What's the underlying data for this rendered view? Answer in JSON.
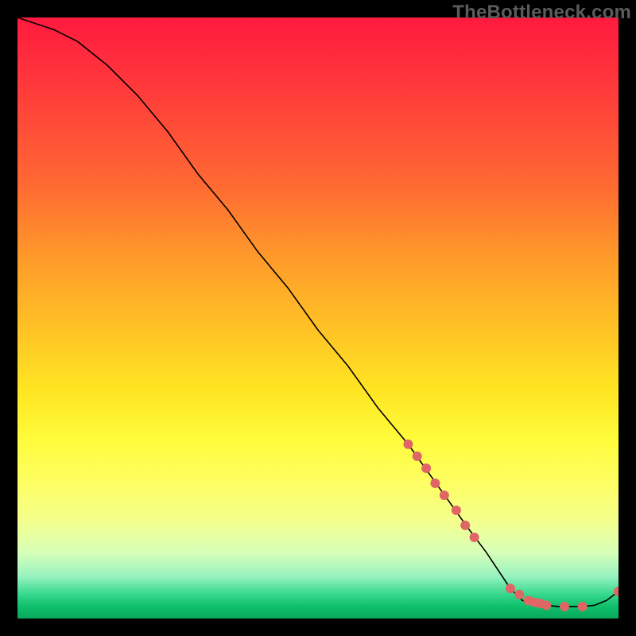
{
  "watermark": "TheBottleneck.com",
  "chart_data": {
    "type": "line",
    "title": "",
    "xlabel": "",
    "ylabel": "",
    "xlim": [
      0,
      100
    ],
    "ylim": [
      0,
      100
    ],
    "grid": false,
    "legend": false,
    "series": [
      {
        "name": "bottleneck-curve",
        "color": "#000000",
        "x": [
          0,
          3,
          6,
          10,
          15,
          20,
          25,
          30,
          35,
          40,
          45,
          50,
          55,
          60,
          65,
          70,
          75,
          78,
          80,
          82,
          84,
          86,
          88,
          90,
          92,
          94,
          96,
          98,
          100
        ],
        "y": [
          100,
          99,
          98,
          96,
          92,
          87,
          81,
          74,
          68,
          61,
          55,
          48,
          42,
          35,
          29,
          22,
          15,
          11,
          8,
          5,
          3,
          2.5,
          2.2,
          2.0,
          2.0,
          2.0,
          2.2,
          3.0,
          4.5
        ]
      }
    ],
    "markers": [
      {
        "name": "highlight-dots",
        "color": "#e06666",
        "radius": 6,
        "points": [
          {
            "x": 65.0,
            "y": 29.0
          },
          {
            "x": 66.5,
            "y": 27.0
          },
          {
            "x": 68.0,
            "y": 25.0
          },
          {
            "x": 69.5,
            "y": 22.5
          },
          {
            "x": 71.0,
            "y": 20.5
          },
          {
            "x": 73.0,
            "y": 18.0
          },
          {
            "x": 74.5,
            "y": 15.5
          },
          {
            "x": 76.0,
            "y": 13.5
          },
          {
            "x": 82.0,
            "y": 5.0
          },
          {
            "x": 83.5,
            "y": 4.0
          },
          {
            "x": 85.0,
            "y": 3.0
          },
          {
            "x": 86.0,
            "y": 2.7
          },
          {
            "x": 87.0,
            "y": 2.5
          },
          {
            "x": 88.0,
            "y": 2.2
          },
          {
            "x": 91.0,
            "y": 2.0
          },
          {
            "x": 94.0,
            "y": 2.0
          },
          {
            "x": 100.0,
            "y": 4.5
          }
        ]
      }
    ]
  }
}
